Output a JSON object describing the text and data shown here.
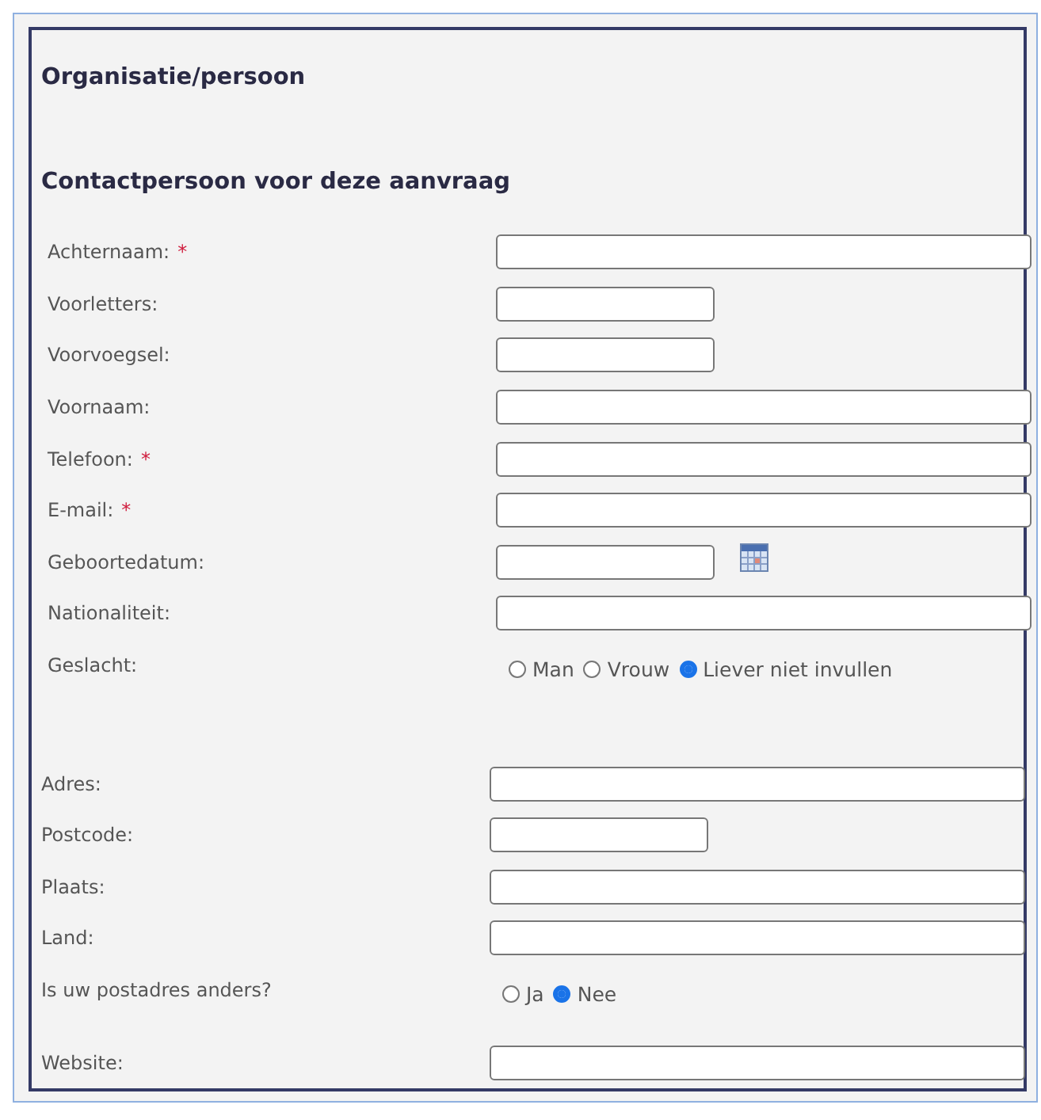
{
  "title": "Organisatie/persoon",
  "subtitle": "Contactpersoon voor deze aanvraag",
  "sections": [
    {
      "rows": [
        {
          "label": "Achternaam:",
          "mark": "*",
          "kind": "wide"
        },
        {
          "label": "Voorletters:",
          "kind": "short"
        },
        {
          "label": "Voorvoegsel:",
          "kind": "short"
        },
        {
          "label": "Voornaam:",
          "kind": "wide"
        },
        {
          "label": "Telefoon:",
          "mark": "*",
          "kind": "wide"
        },
        {
          "label": "E-mail:",
          "mark": "*",
          "kind": "wide"
        },
        {
          "label": "Geboortedatum:",
          "kind": "date"
        },
        {
          "label": "Nationaliteit:",
          "kind": "wide"
        },
        {
          "label": "Geslacht:",
          "kind": "radio",
          "options": [
            {
              "label": "Man",
              "selected": false
            },
            {
              "label": "Vrouw",
              "selected": false
            },
            {
              "label": "Liever niet invullen",
              "selected": true
            }
          ]
        }
      ]
    },
    {
      "rows": [
        {
          "label": "Adres:",
          "kind": "wide"
        },
        {
          "label": "Postcode:",
          "kind": "short"
        },
        {
          "label": "Plaats:",
          "kind": "wide"
        },
        {
          "label": "Land:",
          "kind": "wide"
        },
        {
          "label": "Is uw postadres anders?",
          "kind": "radio",
          "options": [
            {
              "label": "Ja",
              "selected": false
            },
            {
              "label": "Nee",
              "selected": true
            }
          ]
        },
        {
          "label": "Website:",
          "kind": "wide"
        }
      ]
    }
  ]
}
